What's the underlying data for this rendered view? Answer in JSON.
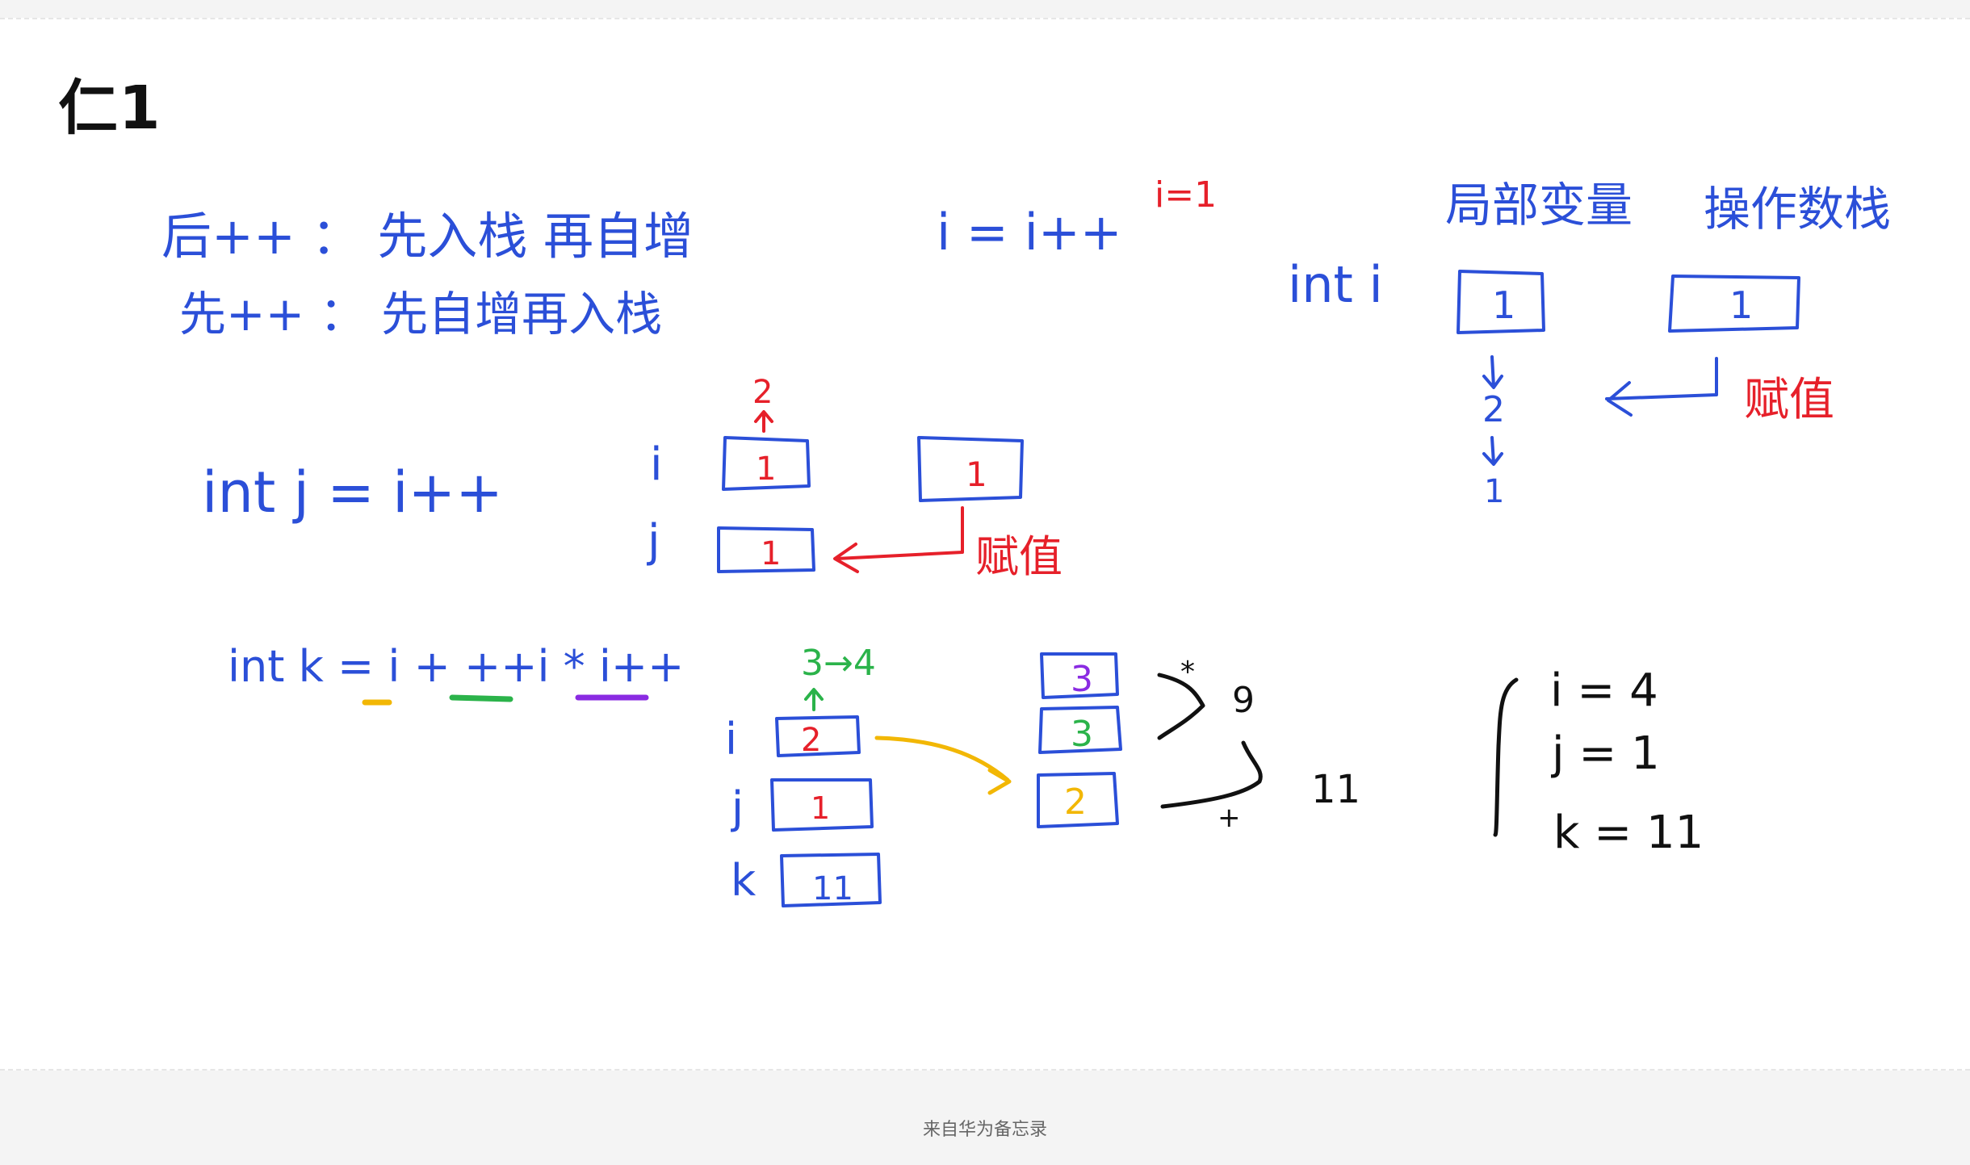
{
  "note": {
    "title": "仁1",
    "colors": {
      "blue": "#2b4fd8",
      "red": "#e6202a",
      "green": "#2bb34a",
      "purple": "#8a2be2",
      "yellow": "#f2b705",
      "black": "#111111"
    }
  },
  "handwriting": {
    "rule_post": "后++ ： 先入栈 再自增",
    "rule_pre": "先++ ： 先自增再入栈",
    "assign_expr": "i = i++",
    "assign_result": "i=1",
    "label_local_vars": "局部变量",
    "label_operand_stack": "操作数栈",
    "decl_i": "int i",
    "local_i_value": "1",
    "operand_stack_value": "1",
    "increment_value": "2",
    "final_i_value": "1",
    "label_assign_1": "赋值",
    "expr_j": "int j = i++",
    "var_i": "i",
    "var_j": "j",
    "var_k": "k",
    "ex2_i_value": "1",
    "ex2_i_increment": "2",
    "ex2_j_value": "1",
    "ex2_stack_value": "1",
    "label_assign_2": "赋值",
    "expr_k": "int k = i + ++i * i++",
    "ex3_i_steps": "3→4",
    "ex3_i_value": "2",
    "ex3_j_value": "1",
    "ex3_k_value": "11",
    "ex3_stack": [
      "3",
      "3",
      "2"
    ],
    "op_mul": "*",
    "op_add": "+",
    "partial_product": "9",
    "sum_result": "11",
    "result_i": "i = 4",
    "result_j": "j = 1",
    "result_k": "k = 11"
  },
  "footer": {
    "source_label": "来自华为备忘录"
  }
}
